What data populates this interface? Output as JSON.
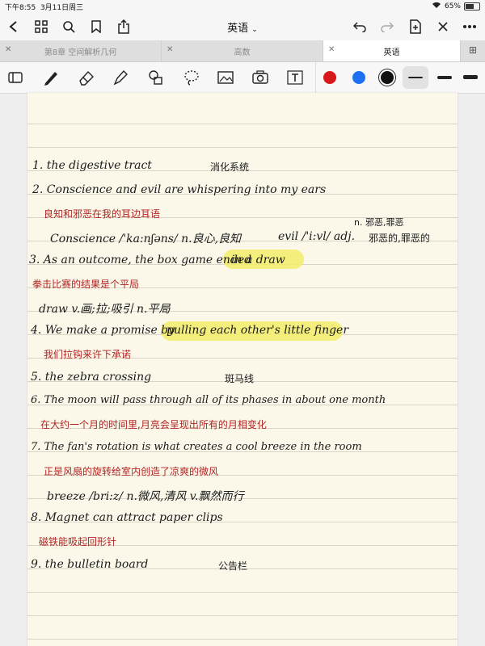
{
  "status": {
    "time": "下午8:55",
    "date": "3月11日周三",
    "battery": "65%"
  },
  "nav": {
    "title": "英语"
  },
  "tabs": [
    {
      "label": "第8章 空间解析几何",
      "active": false
    },
    {
      "label": "高数",
      "active": false
    },
    {
      "label": "英语",
      "active": true
    }
  ],
  "toolbar": {
    "colors": [
      "#d7191c",
      "#1e6ff2",
      "#111111"
    ],
    "tools": [
      "sidebar-icon",
      "pen-icon",
      "eraser-icon",
      "highlighter-icon",
      "shapes-icon",
      "lasso-icon",
      "image-icon",
      "camera-icon",
      "textbox-icon"
    ]
  },
  "notes": [
    {
      "text": "1. the digestive tract",
      "style": "en"
    },
    {
      "text": "消化系统",
      "style": "bk"
    },
    {
      "text": "2. Conscience and evil are whispering into my ears",
      "style": "en"
    },
    {
      "text": "良知和邪恶在我的耳边耳语",
      "style": "red"
    },
    {
      "text": "Conscience /'ka:nʃəns/ n.良心,良知",
      "style": "en"
    },
    {
      "text": "evil /'i:vl/ adj.",
      "style": "en"
    },
    {
      "text": "n. 邪恶,罪恶",
      "style": "bk"
    },
    {
      "text": "邪恶的,罪恶的",
      "style": "bk"
    },
    {
      "text": "3. As an outcome, the box game ended",
      "style": "en"
    },
    {
      "text": "in a draw",
      "style": "en"
    },
    {
      "text": "拳击比赛的结果是个平局",
      "style": "red"
    },
    {
      "text": "draw   v.画;拉;吸引  n.平局",
      "style": "en"
    },
    {
      "text": "4. We make a promise by",
      "style": "en"
    },
    {
      "text": "pulling each other's little finger",
      "style": "en"
    },
    {
      "text": "我们拉钩来许下承诺",
      "style": "red"
    },
    {
      "text": "5. the zebra crossing",
      "style": "en"
    },
    {
      "text": "斑马线",
      "style": "bk"
    },
    {
      "text": "6. The moon will pass through all of its phases in about one month",
      "style": "en"
    },
    {
      "text": "在大约一个月的时间里,月亮会呈现出所有的月相变化",
      "style": "red"
    },
    {
      "text": "7. The fan's rotation is what creates a cool breeze in the room",
      "style": "en"
    },
    {
      "text": "正是风扇的旋转给室内创造了凉爽的微风",
      "style": "red"
    },
    {
      "text": "breeze /bri:z/  n.微风,清风  v.飘然而行",
      "style": "en"
    },
    {
      "text": "8. Magnet can attract paper clips",
      "style": "en"
    },
    {
      "text": "磁铁能吸起回形针",
      "style": "red"
    },
    {
      "text": "9. the bulletin board",
      "style": "en"
    },
    {
      "text": "公告栏",
      "style": "bk"
    }
  ]
}
